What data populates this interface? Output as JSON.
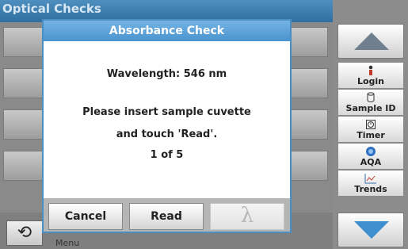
{
  "background": {
    "title": "Optical Checks",
    "menu_label": "Menu",
    "undo_icon": "undo-arrow-icon"
  },
  "side_panel": {
    "items": [
      {
        "label": "Login",
        "icon": "person-icon",
        "glyph": "🯅"
      },
      {
        "label": "Sample ID",
        "icon": "sample-vial-icon",
        "glyph": "▯"
      },
      {
        "label": "Timer",
        "icon": "timer-icon",
        "glyph": "⏲"
      },
      {
        "label": "AQA",
        "icon": "aqa-icon",
        "glyph": "◉"
      },
      {
        "label": "Trends",
        "icon": "trends-chart-icon",
        "glyph": "📈"
      }
    ]
  },
  "dialog": {
    "title": "Absorbance Check",
    "wavelength": "Wavelength: 546 nm",
    "instruction_line1": "Please insert sample cuvette",
    "instruction_line2": "and touch 'Read'.",
    "progress": "1 of 5",
    "cancel_label": "Cancel",
    "read_label": "Read",
    "lambda_label": "λ"
  },
  "colors": {
    "accent": "#4a94cf",
    "title_text": "#ffffff"
  }
}
